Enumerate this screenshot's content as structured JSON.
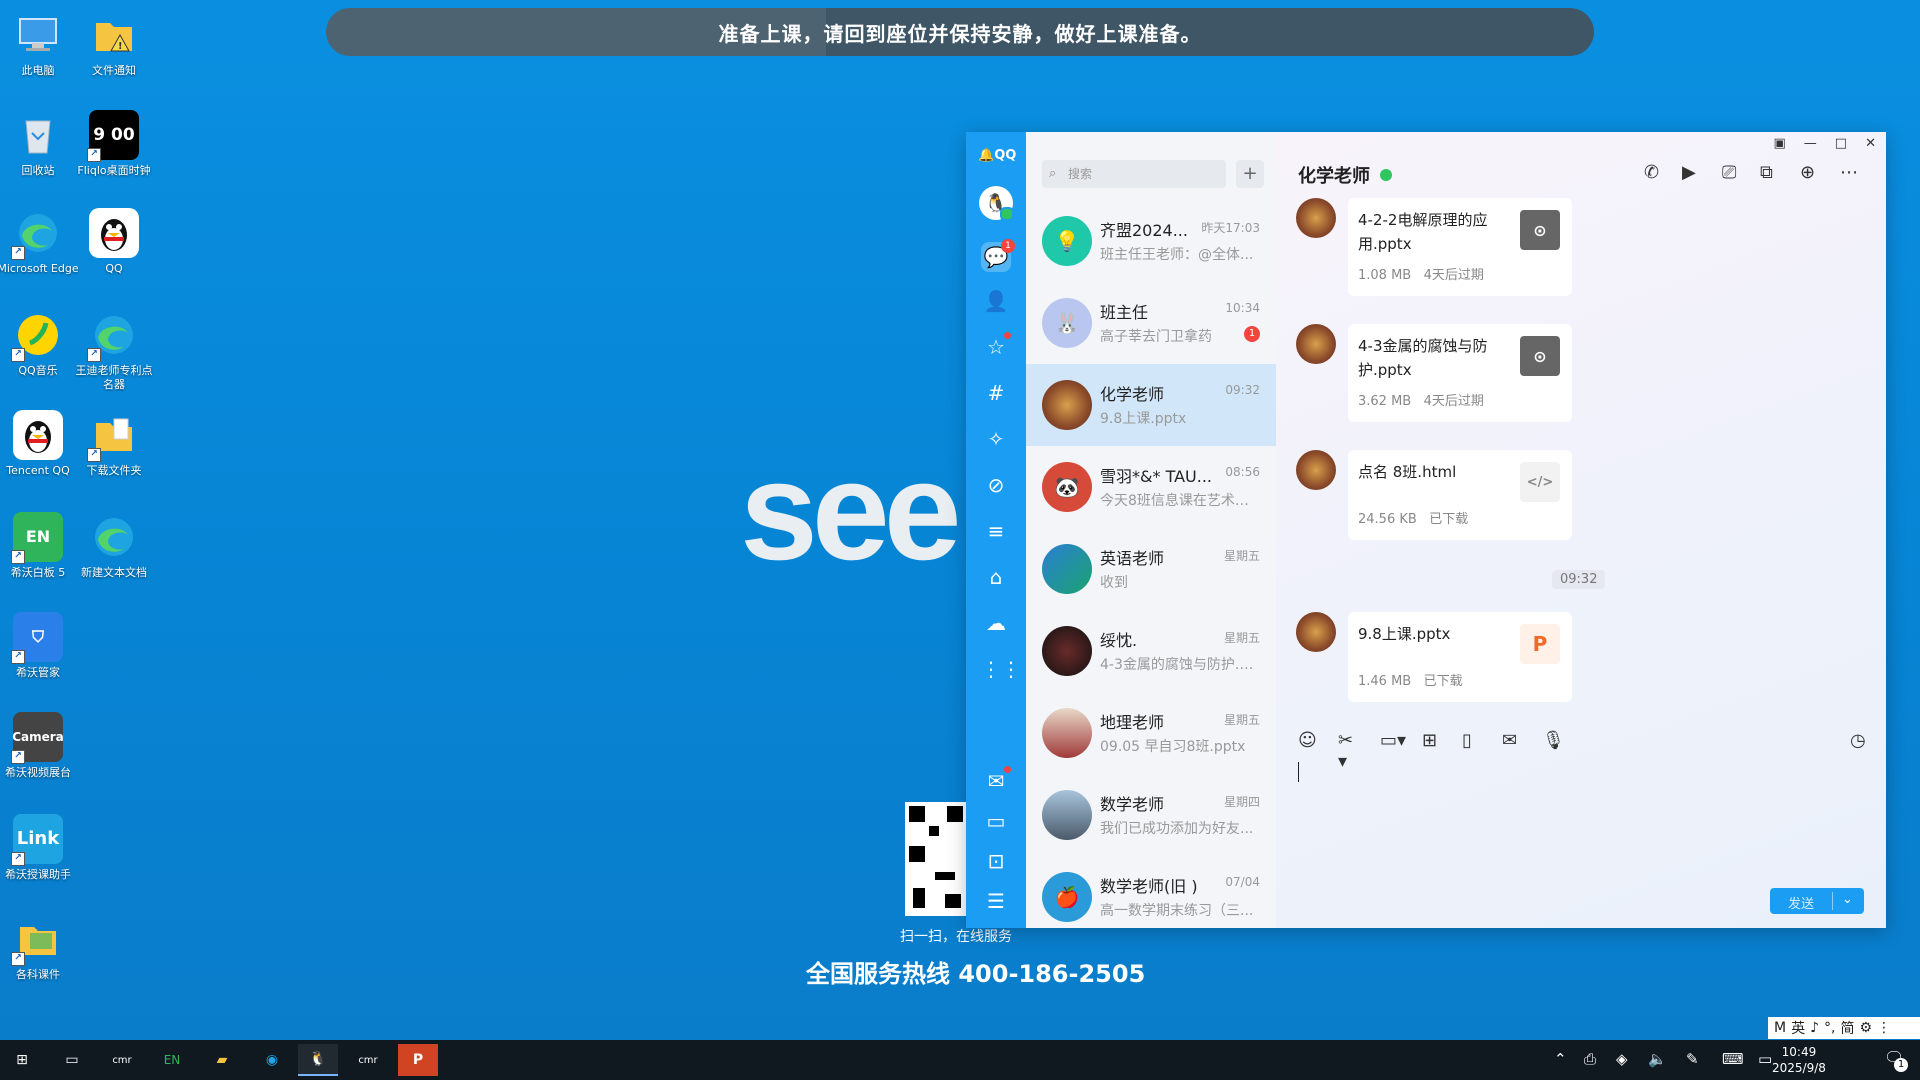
{
  "notice": "准备上课，请回到座位并保持安静，做好上课准备。",
  "desktop": {
    "icons": [
      {
        "label": "此电脑",
        "icon": "computer-icon"
      },
      {
        "label": "文件通知",
        "icon": "folder-warning-icon"
      },
      {
        "label": "回收站",
        "icon": "recycle-bin-icon"
      },
      {
        "label": "Fliqlo桌面时钟",
        "icon": "clock-icon",
        "glyph": "9 00"
      },
      {
        "label": "Microsoft Edge",
        "icon": "edge-icon"
      },
      {
        "label": "QQ",
        "icon": "qq-penguin-icon"
      },
      {
        "label": "QQ音乐",
        "icon": "qq-music-icon"
      },
      {
        "label": "王迪老师专利点名器",
        "icon": "edge-icon"
      },
      {
        "label": "Tencent QQ",
        "icon": "qq-penguin-icon"
      },
      {
        "label": "下载文件夹",
        "icon": "folder-icon"
      },
      {
        "label": "希沃白板 5",
        "icon": "seewo-board-icon",
        "glyph": "EN"
      },
      {
        "label": "新建文本文档",
        "icon": "edge-icon"
      },
      {
        "label": "希沃管家",
        "icon": "shield-icon"
      },
      {
        "label": "希沃视频展台",
        "icon": "camera-icon",
        "glyph": "Camera"
      },
      {
        "label": "希沃授课助手",
        "icon": "link-icon",
        "glyph": "Link"
      },
      {
        "label": "各科课件",
        "icon": "folder-icon"
      }
    ]
  },
  "wallpaper": {
    "brand": "see",
    "scan_text": "扫一扫，在线服务",
    "hotline": "全国服务热线 400-186-2505"
  },
  "qq": {
    "logo": "QQ",
    "nav_badge": "1",
    "search_placeholder": "搜索",
    "add_label": "+",
    "conversations": [
      {
        "name": "齐盟2024...",
        "time": "昨天17:03",
        "preview": "班主任王老师：@全体...",
        "avatar_color": "#1fc8a8",
        "glyph": "💡"
      },
      {
        "name": "班主任",
        "time": "10:34",
        "preview": "高子莘去门卫拿药",
        "badge": "1",
        "avatar_color": "#b9c7f0",
        "glyph": "🐰"
      },
      {
        "name": "化学老师",
        "time": "09:32",
        "preview": "9.8上课.pptx",
        "avatar_color": "#8a4a2a",
        "glyph": ""
      },
      {
        "name": "雪羽*&* TAU...",
        "time": "08:56",
        "preview": "今天8班信息课在艺术楼...",
        "avatar_color": "#d64a3a",
        "glyph": "🐼"
      },
      {
        "name": "英语老师",
        "time": "星期五",
        "preview": "收到",
        "avatar_color": "#2a7fd4",
        "glyph": ""
      },
      {
        "name": "绥忱.",
        "time": "星期五",
        "preview": "4-3金属的腐蚀与防护.p...",
        "avatar_color": "#222222",
        "glyph": ""
      },
      {
        "name": "地理老师",
        "time": "星期五",
        "preview": "09.05 早自习8班.pptx",
        "avatar_color": "#c77a5a",
        "glyph": ""
      },
      {
        "name": "数学老师",
        "time": "星期四",
        "preview": "我们已成功添加为好友...",
        "avatar_color": "#6a8aa6",
        "glyph": ""
      },
      {
        "name": "数学老师(旧 )",
        "time": "07/04",
        "preview": "高一数学期末练习（三...",
        "avatar_color": "#2a9ad8",
        "glyph": "🍎"
      }
    ],
    "chat": {
      "title": "化学老师",
      "messages": [
        {
          "file": "4-2-2电解原理的应用.pptx",
          "size": "1.08 MB",
          "status": "4天后过期",
          "icon": "download-icon",
          "icon_color": "#666666"
        },
        {
          "file": "4-3金属的腐蚀与防护.pptx",
          "size": "3.62 MB",
          "status": "4天后过期",
          "icon": "download-icon",
          "icon_color": "#666666"
        },
        {
          "file": "点名 8班.html",
          "size": "24.56 KB",
          "status": "已下载",
          "icon": "code-file-icon",
          "icon_color": "#f2f2f2"
        },
        {
          "file": "9.8上课.pptx",
          "size": "1.46 MB",
          "status": "已下载",
          "icon": "ppt-file-icon",
          "icon_color": "#fff1e8"
        }
      ],
      "time_divider": "09:32",
      "send_label": "发送"
    }
  },
  "ime": [
    "M",
    "英",
    "♪",
    "°,",
    "简",
    "⚙",
    "⋮"
  ],
  "taskbar": {
    "clock_time": "10:49",
    "clock_date": "2025/9/8",
    "notifications": "1"
  }
}
